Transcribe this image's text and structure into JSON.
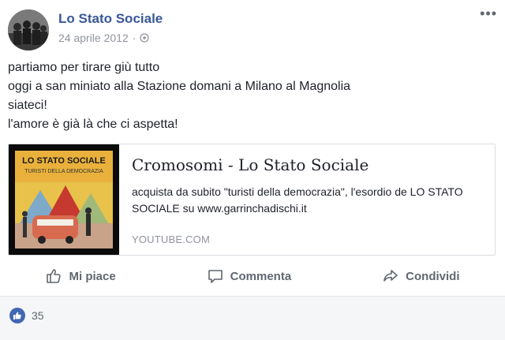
{
  "post": {
    "author": "Lo Stato Sociale",
    "date": "24 aprile 2012",
    "separator": "·",
    "audience_icon": "globe-icon",
    "lines": [
      "partiamo per tirare giù tutto",
      "oggi a san miniato alla Stazione domani a Milano al Magnolia",
      "siateci!",
      "l'amore è già là che ci aspetta!"
    ]
  },
  "link_card": {
    "title": "Cromosomi - Lo Stato Sociale",
    "description": "acquista da subito \"turisti della democrazia\", l'esordio de LO STATO SOCIALE su www.garrinchadischi.it",
    "source": "YOUTUBE.COM",
    "thumb_title": "LO STATO SOCIALE",
    "thumb_subtitle": "TURISTI DELLA DEMOCRAZIA"
  },
  "actions": {
    "like": "Mi piace",
    "comment": "Commenta",
    "share": "Condividi"
  },
  "reactions": {
    "count": "35",
    "icon": "like-reaction-icon"
  },
  "colors": {
    "brand": "#385898",
    "muted": "#90949c",
    "action": "#606770",
    "like_blue": "#4267b2"
  }
}
